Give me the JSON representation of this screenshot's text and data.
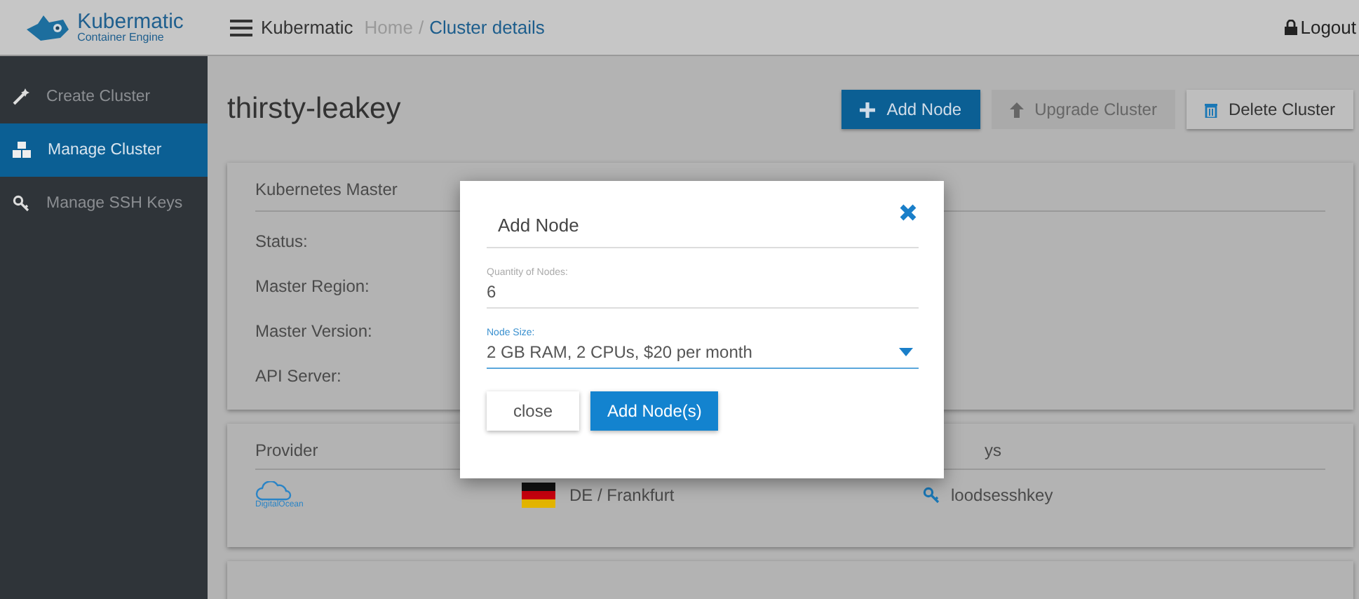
{
  "header": {
    "logo_title": "Kubermatic",
    "logo_subtitle": "Container Engine",
    "app_name": "Kubermatic",
    "breadcrumbs": [
      {
        "label": "Home",
        "selected": false
      },
      {
        "label": "Cluster details",
        "selected": true
      }
    ],
    "separator": "/",
    "logout": "Logout"
  },
  "sidebar": {
    "items": [
      {
        "label": "Create Cluster",
        "kind": "create",
        "selected": false
      },
      {
        "label": "Manage Cluster",
        "kind": "cluster",
        "selected": true
      },
      {
        "label": "Manage SSH Keys",
        "kind": "key",
        "selected": false
      }
    ]
  },
  "cluster": {
    "name": "thirsty-leakey",
    "actions": [
      {
        "label": "Add Node",
        "kind": "add",
        "disabled": false
      },
      {
        "label": "Upgrade Cluster",
        "kind": "upgrade",
        "disabled": true
      },
      {
        "label": "Delete Cluster",
        "kind": "delete",
        "disabled": false
      }
    ]
  },
  "master_card": {
    "title": "Kubernetes Master",
    "fields": [
      "Status:",
      "Master Region:",
      "Master Version:",
      "API Server:"
    ]
  },
  "provider_card": {
    "provider_header": "Provider",
    "keys_header": "ys",
    "provider_logo_text": "DigitalOcean",
    "region": "DE / Frankfurt",
    "ssh_key": "loodsesshkey"
  },
  "dialog": {
    "title": "Add Node",
    "quantity": {
      "label": "Quantity of Nodes:",
      "value": "6"
    },
    "node_size": {
      "label": "Node Size:",
      "value": "2 GB RAM, 2 CPUs, $20 per month"
    },
    "buttons": [
      {
        "label": "close",
        "kind": "secondary"
      },
      {
        "label": "Add Node(s)",
        "kind": "primary"
      }
    ]
  }
}
